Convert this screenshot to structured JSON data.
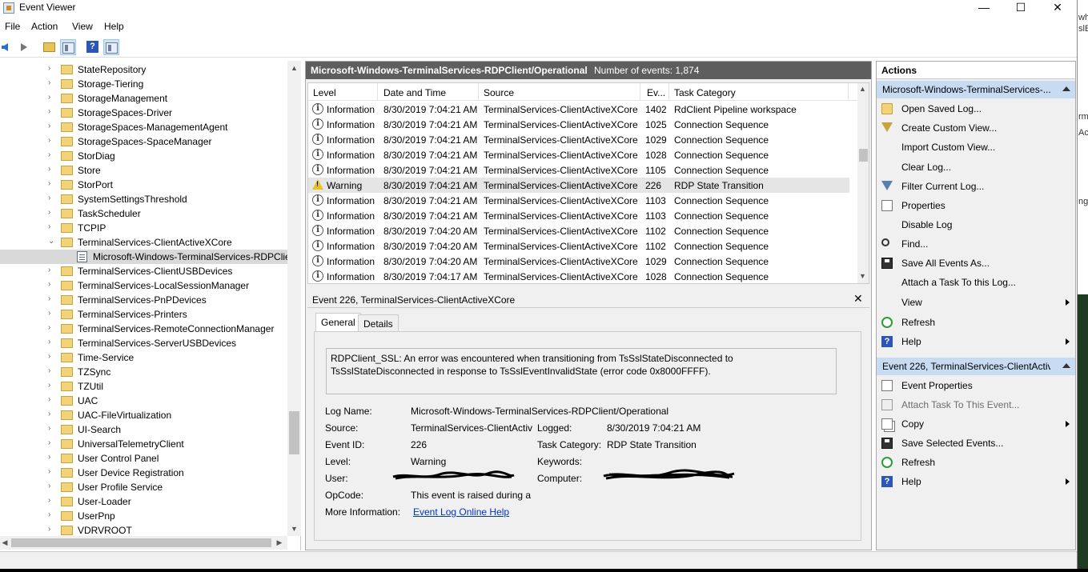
{
  "window": {
    "title": "Event Viewer",
    "minimize": "—",
    "maximize": "☐",
    "close": "✕"
  },
  "menu": [
    "File",
    "Action",
    "View",
    "Help"
  ],
  "tree": {
    "items": [
      {
        "label": "StateRepository",
        "expanded": false
      },
      {
        "label": "Storage-Tiering",
        "expanded": false
      },
      {
        "label": "StorageManagement",
        "expanded": false
      },
      {
        "label": "StorageSpaces-Driver",
        "expanded": false
      },
      {
        "label": "StorageSpaces-ManagementAgent",
        "expanded": false
      },
      {
        "label": "StorageSpaces-SpaceManager",
        "expanded": false
      },
      {
        "label": "StorDiag",
        "expanded": false
      },
      {
        "label": "Store",
        "expanded": false
      },
      {
        "label": "StorPort",
        "expanded": false
      },
      {
        "label": "SystemSettingsThreshold",
        "expanded": false
      },
      {
        "label": "TaskScheduler",
        "expanded": false
      },
      {
        "label": "TCPIP",
        "expanded": false
      },
      {
        "label": "TerminalServices-ClientActiveXCore",
        "expanded": true
      },
      {
        "label": "Microsoft-Windows-TerminalServices-RDPClient/Operational",
        "selected": true
      },
      {
        "label": "TerminalServices-ClientUSBDevices",
        "expanded": false
      },
      {
        "label": "TerminalServices-LocalSessionManager",
        "expanded": false
      },
      {
        "label": "TerminalServices-PnPDevices",
        "expanded": false
      },
      {
        "label": "TerminalServices-Printers",
        "expanded": false
      },
      {
        "label": "TerminalServices-RemoteConnectionManager",
        "expanded": false
      },
      {
        "label": "TerminalServices-ServerUSBDevices",
        "expanded": false
      },
      {
        "label": "Time-Service",
        "expanded": false
      },
      {
        "label": "TZSync",
        "expanded": false
      },
      {
        "label": "TZUtil",
        "expanded": false
      },
      {
        "label": "UAC",
        "expanded": false
      },
      {
        "label": "UAC-FileVirtualization",
        "expanded": false
      },
      {
        "label": "UI-Search",
        "expanded": false
      },
      {
        "label": "UniversalTelemetryClient",
        "expanded": false
      },
      {
        "label": "User Control Panel",
        "expanded": false
      },
      {
        "label": "User Device Registration",
        "expanded": false
      },
      {
        "label": "User Profile Service",
        "expanded": false
      },
      {
        "label": "User-Loader",
        "expanded": false
      },
      {
        "label": "UserPnp",
        "expanded": false
      },
      {
        "label": "VDRVROOT",
        "expanded": false
      }
    ]
  },
  "log": {
    "name": "Microsoft-Windows-TerminalServices-RDPClient/Operational",
    "count": "Number of events: 1,874",
    "columns": [
      "Level",
      "Date and Time",
      "Source",
      "Ev...",
      "Task Category"
    ],
    "rows": [
      {
        "level": "Information",
        "date": "8/30/2019 7:04:21 AM",
        "source": "TerminalServices-ClientActiveXCore",
        "id": "1402",
        "task": "RdClient Pipeline workspace"
      },
      {
        "level": "Information",
        "date": "8/30/2019 7:04:21 AM",
        "source": "TerminalServices-ClientActiveXCore",
        "id": "1025",
        "task": "Connection Sequence"
      },
      {
        "level": "Information",
        "date": "8/30/2019 7:04:21 AM",
        "source": "TerminalServices-ClientActiveXCore",
        "id": "1029",
        "task": "Connection Sequence"
      },
      {
        "level": "Information",
        "date": "8/30/2019 7:04:21 AM",
        "source": "TerminalServices-ClientActiveXCore",
        "id": "1028",
        "task": "Connection Sequence"
      },
      {
        "level": "Information",
        "date": "8/30/2019 7:04:21 AM",
        "source": "TerminalServices-ClientActiveXCore",
        "id": "1105",
        "task": "Connection Sequence"
      },
      {
        "level": "Warning",
        "date": "8/30/2019 7:04:21 AM",
        "source": "TerminalServices-ClientActiveXCore",
        "id": "226",
        "task": "RDP State Transition"
      },
      {
        "level": "Information",
        "date": "8/30/2019 7:04:21 AM",
        "source": "TerminalServices-ClientActiveXCore",
        "id": "1103",
        "task": "Connection Sequence"
      },
      {
        "level": "Information",
        "date": "8/30/2019 7:04:21 AM",
        "source": "TerminalServices-ClientActiveXCore",
        "id": "1103",
        "task": "Connection Sequence"
      },
      {
        "level": "Information",
        "date": "8/30/2019 7:04:20 AM",
        "source": "TerminalServices-ClientActiveXCore",
        "id": "1102",
        "task": "Connection Sequence"
      },
      {
        "level": "Information",
        "date": "8/30/2019 7:04:20 AM",
        "source": "TerminalServices-ClientActiveXCore",
        "id": "1102",
        "task": "Connection Sequence"
      },
      {
        "level": "Information",
        "date": "8/30/2019 7:04:20 AM",
        "source": "TerminalServices-ClientActiveXCore",
        "id": "1029",
        "task": "Connection Sequence"
      },
      {
        "level": "Information",
        "date": "8/30/2019 7:04:17 AM",
        "source": "TerminalServices-ClientActiveXCore",
        "id": "1028",
        "task": "Connection Sequence"
      }
    ]
  },
  "detail": {
    "title": "Event 226, TerminalServices-ClientActiveXCore",
    "close": "✕",
    "tabs": [
      "General",
      "Details"
    ],
    "message": "RDPClient_SSL: An error was encountered when transitioning from TsSslStateDisconnected to TsSslStateDisconnected in response to TsSslEventInvalidState (error code 0x8000FFFF).",
    "labels": {
      "log_name": "Log Name:",
      "source": "Source:",
      "event_id": "Event ID:",
      "level": "Level:",
      "user": "User:",
      "opcode": "OpCode:",
      "more_info": "More Information:",
      "logged": "Logged:",
      "task_category": "Task Category:",
      "keywords": "Keywords:",
      "computer": "Computer:"
    },
    "values": {
      "log_name": "Microsoft-Windows-TerminalServices-RDPClient/Operational",
      "source": "TerminalServices-ClientActiv",
      "event_id": "226",
      "level": "Warning",
      "opcode": "This event is raised during a",
      "more_info_link": "Event Log Online Help",
      "logged": "8/30/2019 7:04:21 AM",
      "task_category": "RDP State Transition"
    }
  },
  "actions": {
    "title": "Actions",
    "section1": "Microsoft-Windows-TerminalServices-...",
    "items1": [
      {
        "label": "Open Saved Log...",
        "icon": "folder-icon"
      },
      {
        "label": "Create Custom View...",
        "icon": "filter-icon"
      },
      {
        "label": "Import Custom View...",
        "icon": "none"
      },
      {
        "label": "Clear Log...",
        "icon": "none"
      },
      {
        "label": "Filter Current Log...",
        "icon": "filter-icon"
      },
      {
        "label": "Properties",
        "icon": "properties-icon"
      },
      {
        "label": "Disable Log",
        "icon": "none"
      },
      {
        "label": "Find...",
        "icon": "binoculars-icon"
      },
      {
        "label": "Save All Events As...",
        "icon": "save-icon"
      },
      {
        "label": "Attach a Task To this Log...",
        "icon": "none"
      },
      {
        "label": "View",
        "icon": "none",
        "submenu": true
      },
      {
        "label": "Refresh",
        "icon": "refresh-icon"
      },
      {
        "label": "Help",
        "icon": "help-icon",
        "submenu": true
      }
    ],
    "section2": "Event 226, TerminalServices-ClientActiv...",
    "items2": [
      {
        "label": "Event Properties",
        "icon": "properties-icon"
      },
      {
        "label": "Attach Task To This Event...",
        "icon": "task-icon",
        "disabled": true
      },
      {
        "label": "Copy",
        "icon": "copy-icon",
        "submenu": true
      },
      {
        "label": "Save Selected Events...",
        "icon": "save-icon"
      },
      {
        "label": "Refresh",
        "icon": "refresh-icon"
      },
      {
        "label": "Help",
        "icon": "help-icon",
        "submenu": true
      }
    ]
  },
  "bg_window_text": [
    "whe",
    "slEv",
    "rm",
    "Ac",
    "ng"
  ]
}
